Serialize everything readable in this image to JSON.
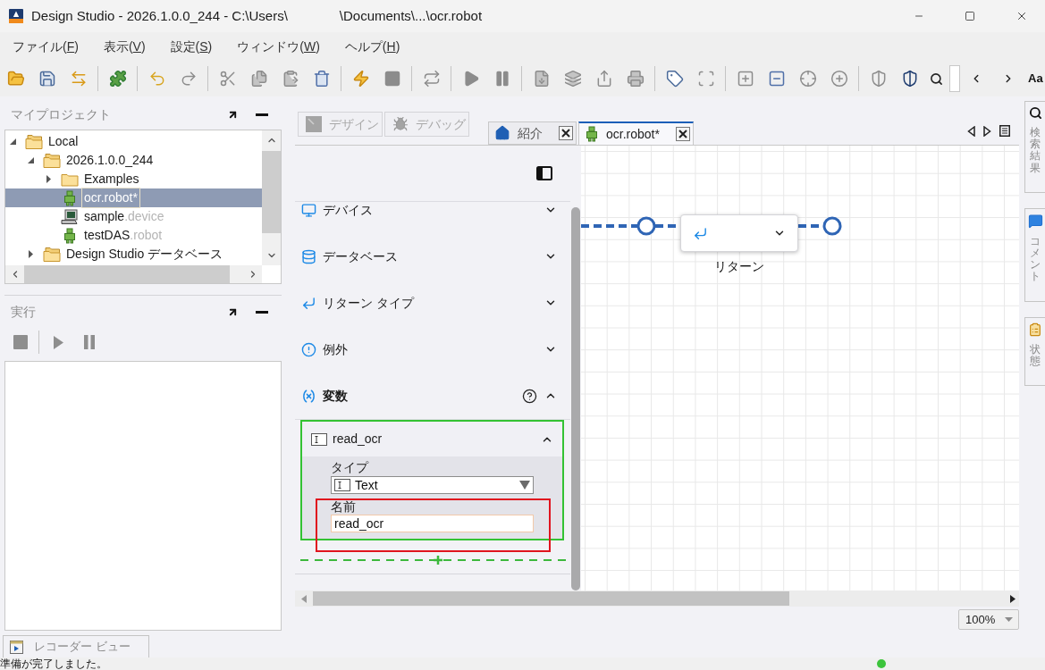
{
  "window": {
    "title": "Design Studio - 2026.1.0.0_244 - C:\\Users\\",
    "title_tail": "\\Documents\\...\\ocr.robot"
  },
  "menu": [
    {
      "label": "ファイル(",
      "mnemonic": "F",
      "suffix": ")"
    },
    {
      "label": "表示(",
      "mnemonic": "V",
      "suffix": ")"
    },
    {
      "label": "設定(",
      "mnemonic": "S",
      "suffix": ")"
    },
    {
      "label": "ウィンドウ(",
      "mnemonic": "W",
      "suffix": ")"
    },
    {
      "label": "ヘルプ(",
      "mnemonic": "H",
      "suffix": ")"
    }
  ],
  "toolbar": {
    "font_button": "Aa"
  },
  "project_panel": {
    "title": "マイプロジェクト",
    "tree": [
      {
        "label": "Local",
        "kind": "folder_open",
        "expanded": true,
        "selected": false,
        "children": [
          {
            "label": "2026.1.0.0_244",
            "kind": "folder_open",
            "expanded": true,
            "selected": false,
            "children": [
              {
                "label": "Examples",
                "kind": "folder",
                "expanded": false,
                "selected": false
              },
              {
                "label": "ocr.robot*",
                "kind": "robot",
                "selected": true
              },
              {
                "label": "sample",
                "suffix": ".device",
                "kind": "device",
                "selected": false
              },
              {
                "label": "testDAS",
                "suffix": ".robot",
                "kind": "robot",
                "selected": false
              }
            ]
          },
          {
            "label": "Design Studio データベース",
            "kind": "folder_open",
            "expanded": false,
            "selected": false
          }
        ]
      }
    ]
  },
  "run_panel": {
    "title": "実行"
  },
  "mode_buttons": [
    {
      "label": "デザイン",
      "kind": "design",
      "disabled": true
    },
    {
      "label": "デバッグ",
      "kind": "debug",
      "disabled": true
    }
  ],
  "editor_tabs": [
    {
      "label": "紹介",
      "kind": "home",
      "selected": false
    },
    {
      "label": "ocr.robot*",
      "kind": "robot",
      "selected": true
    }
  ],
  "properties": {
    "sections": [
      {
        "label": "デバイス",
        "kind": "device",
        "expanded": false,
        "help": false
      },
      {
        "label": "データベース",
        "kind": "database",
        "expanded": false,
        "help": false
      },
      {
        "label": "リターン タイプ",
        "kind": "return",
        "expanded": false,
        "help": false
      },
      {
        "label": "例外",
        "kind": "exception",
        "expanded": false,
        "help": false
      },
      {
        "label": "変数",
        "kind": "variable",
        "expanded": true,
        "help": true,
        "variables": [
          {
            "name": "read_ocr",
            "selected": true,
            "expanded": true,
            "type_label": "タイプ",
            "type_value": "Text",
            "name_label": "名前",
            "name_value": "read_ocr",
            "name_highlighted": true
          }
        ]
      }
    ]
  },
  "canvas": {
    "nodes": [
      {
        "label": "リターン",
        "kind": "return"
      }
    ]
  },
  "zoom_select": {
    "value": "100%"
  },
  "side_tabs": [
    {
      "label": "検索結果",
      "kind": "search"
    },
    {
      "label": "コメント",
      "kind": "comment"
    },
    {
      "label": "状態",
      "kind": "state"
    }
  ],
  "bottom_tabs": [
    {
      "label": "レコーダー ビュー"
    }
  ],
  "status_bar": {
    "text": "準備が完了しました。"
  }
}
